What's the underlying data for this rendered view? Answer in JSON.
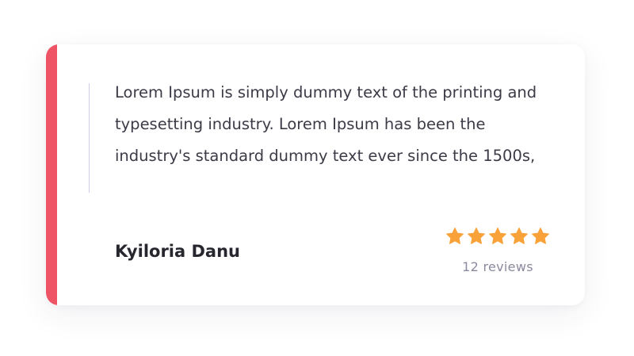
{
  "testimonial": {
    "quote": "Lorem Ipsum is simply dummy text of the printing and typesetting industry. Lorem Ipsum has been the industry's standard dummy text ever since the 1500s,",
    "author": "Kyiloria Danu",
    "rating": 5,
    "rating_max": 5,
    "review_count_label": "12 reviews"
  },
  "colors": {
    "accent": "#ef5466",
    "star": "#f9a23a"
  },
  "icons": {
    "rating_star": "star-icon"
  }
}
